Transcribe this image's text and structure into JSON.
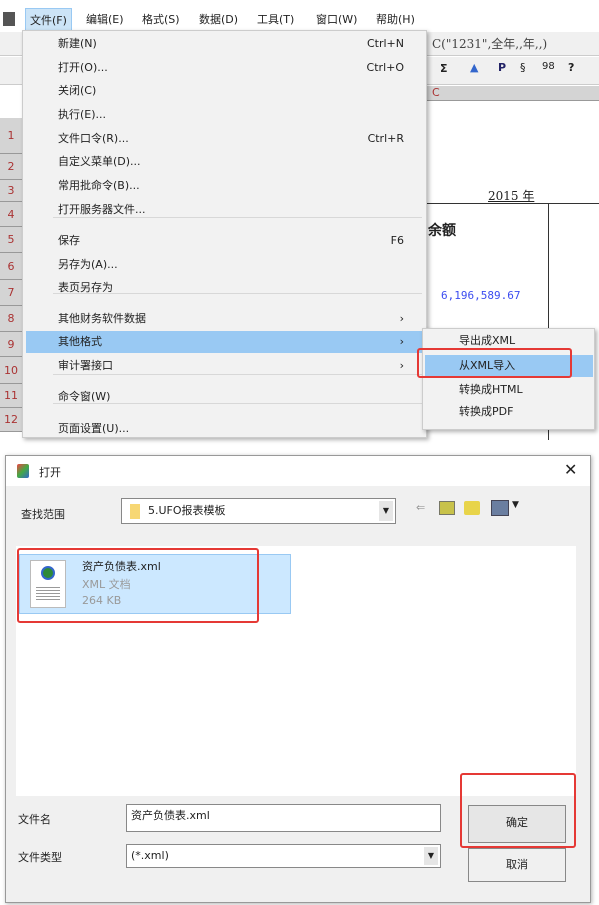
{
  "menubar": {
    "items": [
      "文件(F)",
      "编辑(E)",
      "格式(S)",
      "数据(D)",
      "工具(T)",
      "窗口(W)",
      "帮助(H)"
    ]
  },
  "sheet": {
    "formula": "C(\"1231\",全年,,年,,)",
    "column": "C",
    "year": "2015 年",
    "header": "余额",
    "value": "6,196,589.67",
    "rows": [
      "1",
      "2",
      "3",
      "4",
      "5",
      "6",
      "7",
      "8",
      "9",
      "10",
      "11",
      "12"
    ],
    "toolbar_icons": [
      "sigma-icon",
      "chart-icon",
      "p-icon",
      "format-icon",
      "number-icon",
      "help-icon"
    ]
  },
  "file_menu": {
    "items": [
      {
        "label": "新建(N)",
        "shortcut": "Ctrl+N"
      },
      {
        "label": "打开(O)...",
        "shortcut": "Ctrl+O"
      },
      {
        "label": "关闭(C)",
        "shortcut": ""
      },
      {
        "label": "执行(E)...",
        "shortcut": ""
      },
      {
        "label": "文件口令(R)...",
        "shortcut": "Ctrl+R"
      },
      {
        "label": "自定义菜单(D)...",
        "shortcut": ""
      },
      {
        "label": "常用批命令(B)...",
        "shortcut": ""
      },
      {
        "label": "打开服务器文件...",
        "shortcut": ""
      },
      {
        "label": "保存",
        "shortcut": "F6"
      },
      {
        "label": "另存为(A)...",
        "shortcut": ""
      },
      {
        "label": "表页另存为",
        "shortcut": ""
      },
      {
        "label": "其他财务软件数据",
        "shortcut": "›"
      },
      {
        "label": "其他格式",
        "shortcut": "›"
      },
      {
        "label": "审计署接口",
        "shortcut": "›"
      },
      {
        "label": "命令窗(W)",
        "shortcut": ""
      },
      {
        "label": "页面设置(U)...",
        "shortcut": ""
      }
    ]
  },
  "submenu": {
    "items": [
      "导出成XML",
      "从XML导入",
      "转换成HTML",
      "转换成PDF"
    ],
    "selected": "从XML导入"
  },
  "dialog": {
    "title": "打开",
    "look_in_label": "查找范围",
    "look_in_value": "5.UFO报表模板",
    "file": {
      "name": "资产负债表.xml",
      "type": "XML 文档",
      "size": "264 KB"
    },
    "filename_label": "文件名",
    "filename_value": "资产负债表.xml",
    "filetype_label": "文件类型",
    "filetype_value": "(*.xml)",
    "ok": "确定",
    "cancel": "取消"
  },
  "colors": {
    "highlight": "#99c9f3",
    "annotation": "#e53935",
    "value_blue": "#3b4cf0"
  }
}
